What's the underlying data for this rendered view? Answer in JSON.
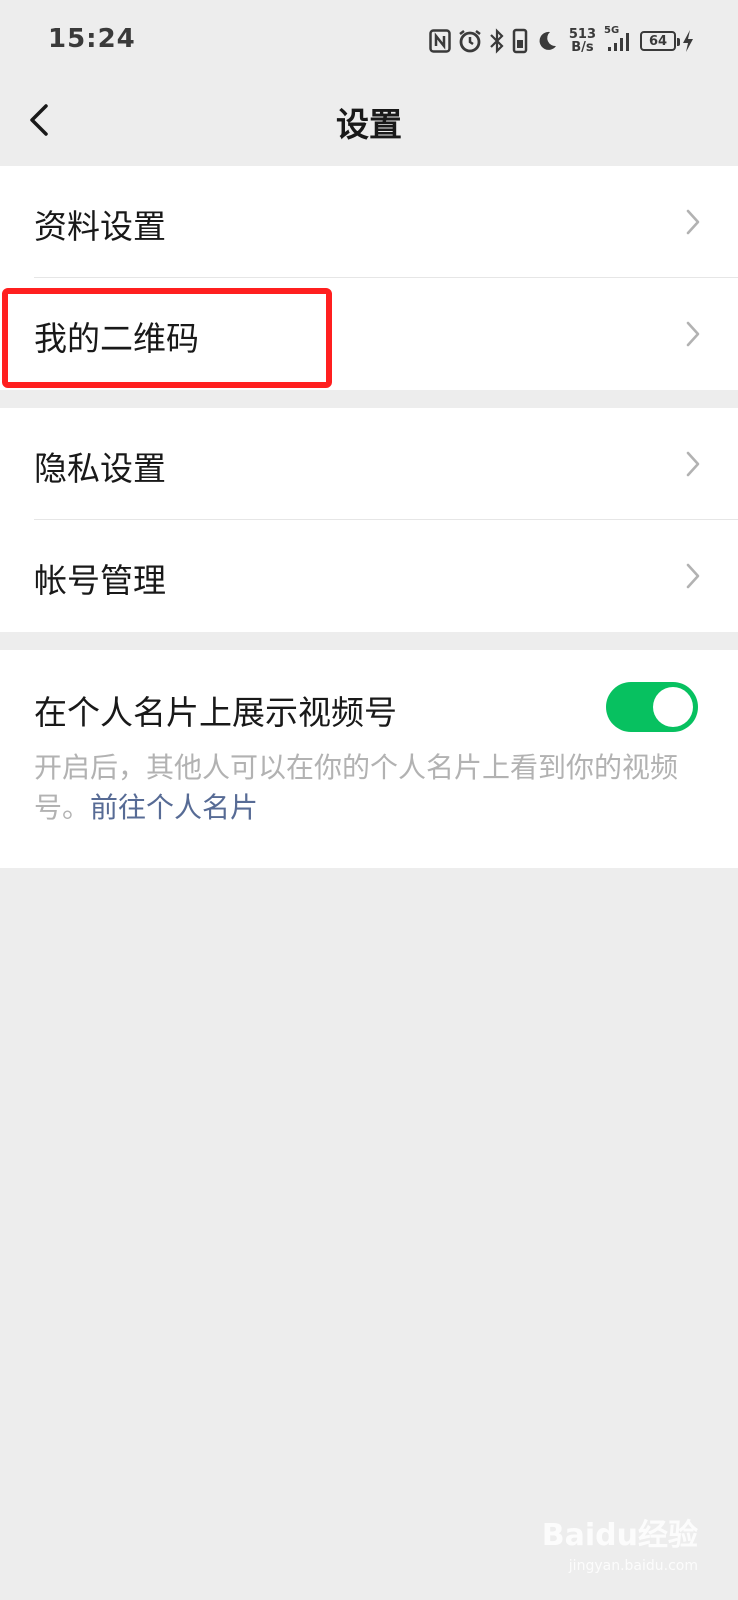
{
  "status_bar": {
    "time": "15:24",
    "net_speed_value": "513",
    "net_speed_unit": "B/s",
    "network_type": "5G",
    "battery_level": "64",
    "icons": [
      "nfc-icon",
      "alarm-icon",
      "bluetooth-icon",
      "vibrate-icon",
      "moon-icon",
      "signal-icon",
      "charging-icon"
    ]
  },
  "nav": {
    "title": "设置"
  },
  "groups": [
    {
      "items": [
        {
          "label": "资料设置"
        },
        {
          "label": "我的二维码"
        }
      ]
    },
    {
      "items": [
        {
          "label": "隐私设置"
        },
        {
          "label": "帐号管理"
        }
      ]
    }
  ],
  "video_card": {
    "label": "在个人名片上展示视频号",
    "toggle_on": true,
    "toggle_color": "#07c160",
    "description": "开启后，其他人可以在你的个人名片上看到你的视频号。",
    "link_text": "前往个人名片"
  },
  "annotation": {
    "highlight_color": "#ff1f1f"
  },
  "watermark": {
    "text": "Baidu经验",
    "sub": "jingyan.baidu.com"
  }
}
